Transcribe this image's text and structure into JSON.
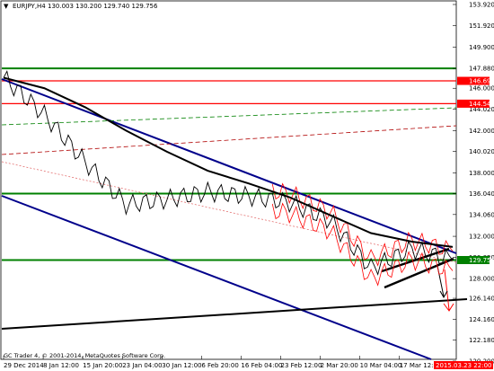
{
  "header": {
    "symbol_line": "EURJPY,H4  130.003 130.200 129.740 129.756",
    "arrow_glyph": "▼"
  },
  "footer": {
    "copyright": "GC Trader 4, © 2001-2014, MetaQuotes Software Corp."
  },
  "price_axis": {
    "ticks": [
      "153.920",
      "151.920",
      "149.900",
      "147.880",
      "146.000",
      "144.020",
      "142.000",
      "140.020",
      "138.000",
      "136.040",
      "134.060",
      "132.000",
      "130.020",
      "128.000",
      "126.140",
      "124.160",
      "122.180",
      "120.200"
    ]
  },
  "price_badges": [
    {
      "label": "146.698",
      "color": "#ff0000"
    },
    {
      "label": "144.543",
      "color": "#ff0000"
    },
    {
      "label": "129.756",
      "color": "#008000"
    }
  ],
  "time_axis": {
    "labels": [
      "29 Dec 2014",
      "8 Jan 12:00",
      "15 Jan 20:00",
      "23 Jan 04:00",
      "30 Jan 12:00",
      "6 Feb 20:00",
      "16 Feb 04:00",
      "23 Feb 12:00",
      "2 Mar 20:00",
      "10 Mar 04:00",
      "17 Mar 12:00"
    ],
    "current_time_badge": "2015.03.23 22:00"
  },
  "chart_data": {
    "type": "line",
    "symbol": "EURJPY",
    "timeframe": "H4",
    "ohlc_last": {
      "open": 130.003,
      "high": 130.2,
      "low": 129.74,
      "close": 129.756
    },
    "y_range": [
      120.2,
      153.92
    ],
    "x": [
      "29 Dec 2014",
      "8 Jan 12:00",
      "15 Jan 20:00",
      "23 Jan 04:00",
      "30 Jan 12:00",
      "6 Feb 20:00",
      "16 Feb 04:00",
      "23 Feb 12:00",
      "2 Mar 20:00",
      "10 Mar 04:00",
      "17 Mar 12:00",
      "23 Mar 22:00"
    ],
    "series": [
      {
        "values": [
          147.0,
          143.5,
          139.0,
          135.0,
          135.5,
          136.2,
          135.8,
          135.2,
          133.5,
          129.0,
          130.8,
          129.756
        ],
        "color": "#000000"
      },
      {
        "values": [
          147.0,
          146.0,
          144.2,
          142.0,
          140.0,
          138.2,
          137.0,
          135.7,
          134.0,
          132.3,
          131.5,
          131.0
        ],
        "color": "#000000"
      }
    ],
    "horizontal_levels": [
      {
        "price": 147.88,
        "color": "#008000"
      },
      {
        "price": 146.698,
        "color": "#ff0000"
      },
      {
        "price": 144.543,
        "color": "#ff0000"
      },
      {
        "price": 136.04,
        "color": "#008000"
      },
      {
        "price": 129.756,
        "color": "#008000"
      }
    ],
    "colors": {
      "up_level": "#008000",
      "resistance": "#ff0000",
      "channel": "#00008b",
      "ma": "#000000",
      "envelope": "#ff0000"
    }
  }
}
